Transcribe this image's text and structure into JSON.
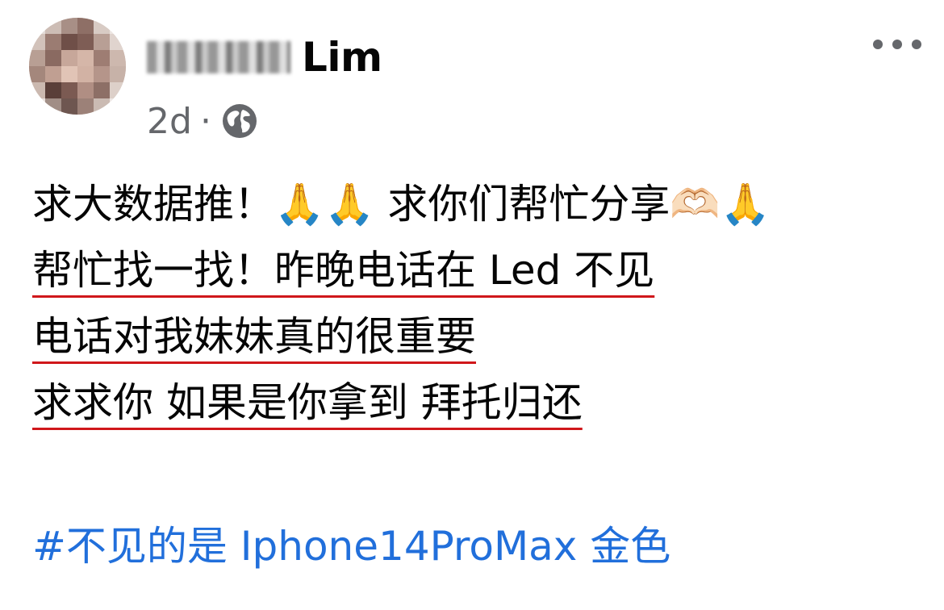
{
  "post": {
    "author": {
      "name_visible": "Lim",
      "avatar": "blurred-profile-photo"
    },
    "timestamp": "2d",
    "separator": "·",
    "privacy_icon": "globe-icon",
    "more_icon": "more-options-icon",
    "lines": [
      "求大数据推！🙏🙏 求你们帮忙分享🫶🏻🙏",
      "帮忙找一找！昨晚电话在 Led 不见",
      "电话对我妹妹真的很重要",
      "求求你 如果是你拿到 拜托归还"
    ],
    "hashtag": "#不见的是 Iphone14ProMax 金色"
  },
  "colors": {
    "text": "#050505",
    "secondary": "#65676b",
    "link": "#216fdb",
    "underline": "#d0171b"
  }
}
